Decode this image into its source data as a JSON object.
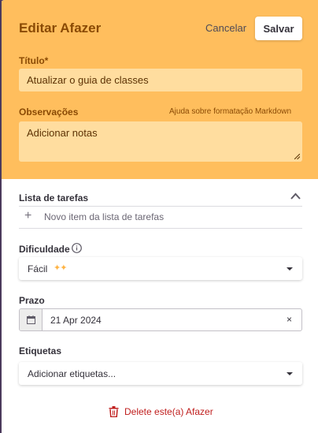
{
  "header": {
    "title": "Editar Afazer",
    "cancel_label": "Cancelar",
    "save_label": "Salvar"
  },
  "title_field": {
    "label": "Título*",
    "value": "Atualizar o guia de classes"
  },
  "notes_field": {
    "label": "Observações",
    "help_link": "Ajuda sobre formatação Markdown",
    "placeholder": "Adicionar notas"
  },
  "checklist": {
    "label": "Lista de tarefas",
    "new_item_placeholder": "Novo item da lista de tarefas"
  },
  "difficulty": {
    "label": "Dificuldade",
    "selected": "Fácil",
    "sparkles": "✦✦"
  },
  "due_date": {
    "label": "Prazo",
    "value": "21 Apr 2024",
    "clear": "×"
  },
  "tags": {
    "label": "Etiquetas",
    "placeholder": "Adicionar etiquetas..."
  },
  "delete": {
    "label": "Delete este(a) Afazer"
  },
  "colors": {
    "header_bg": "#ffbe5d",
    "field_bg": "#ffdd9f",
    "header_text": "#8a4a04",
    "danger": "#c0201f",
    "sparkle": "#ffb445"
  },
  "icons": [
    "info-icon",
    "chevron-up-icon",
    "plus-icon",
    "calendar-icon",
    "trash-icon",
    "caret-down-icon",
    "close-icon"
  ]
}
